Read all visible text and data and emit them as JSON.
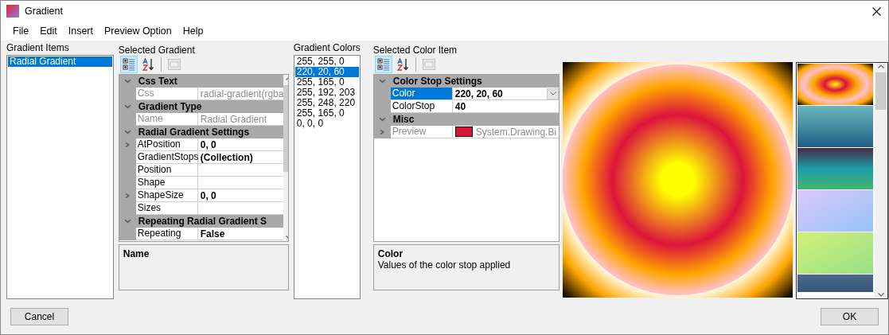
{
  "window": {
    "title": "Gradient"
  },
  "menu": [
    {
      "label": "File"
    },
    {
      "label": "Edit"
    },
    {
      "label": "Insert"
    },
    {
      "label": "Preview Option"
    },
    {
      "label": "Help"
    }
  ],
  "gradient_items": {
    "label": "Gradient Items",
    "items": [
      {
        "label": "Radial Gradient",
        "selected": true
      }
    ]
  },
  "selected_gradient": {
    "label": "Selected Gradient",
    "toolbar": [
      {
        "kind": "categorized",
        "selected": true
      },
      {
        "kind": "alphabetical",
        "selected": false
      },
      {
        "kind": "property-pages",
        "disabled": true
      }
    ],
    "categories": [
      {
        "title": "Css Text",
        "expanded": true,
        "properties": [
          {
            "name": "Css",
            "value": "radial-gradient(rgba",
            "readonly": true,
            "expandable": false,
            "selected": false
          }
        ]
      },
      {
        "title": "Gradient Type",
        "expanded": true,
        "properties": [
          {
            "name": "Name",
            "value": "Radial Gradient",
            "readonly": true,
            "expandable": false,
            "selected": false
          }
        ]
      },
      {
        "title": "Radial Gradient Settings",
        "expanded": true,
        "properties": [
          {
            "name": "AtPosition",
            "value": "0, 0",
            "readonly": false,
            "expandable": true,
            "selected": false
          },
          {
            "name": "GradientStops",
            "value": "(Collection)",
            "readonly": false,
            "expandable": false,
            "selected": false
          },
          {
            "name": "Position",
            "readonly": false,
            "expandable": false,
            "selected": false
          },
          {
            "name": "Shape",
            "readonly": false,
            "expandable": false,
            "selected": false
          },
          {
            "name": "ShapeSize",
            "value": "0, 0",
            "readonly": false,
            "expandable": true,
            "selected": false
          },
          {
            "name": "Sizes",
            "readonly": false,
            "expandable": false,
            "selected": false
          }
        ]
      },
      {
        "title": "Repeating Radial Gradient S",
        "expanded": true,
        "properties": [
          {
            "name": "Repeating",
            "value": "False",
            "readonly": false,
            "expandable": false,
            "selected": false
          }
        ]
      }
    ],
    "help": {
      "title": "Name"
    }
  },
  "gradient_colors": {
    "label": "Gradient Colors",
    "items": [
      {
        "label": "255, 255, 0",
        "selected": false
      },
      {
        "label": "220, 20, 60",
        "selected": true
      },
      {
        "label": "255, 165, 0",
        "selected": false
      },
      {
        "label": "255, 192, 203",
        "selected": false
      },
      {
        "label": "255, 248, 220",
        "selected": false
      },
      {
        "label": "255, 165, 0",
        "selected": false
      },
      {
        "label": "0, 0, 0",
        "selected": false
      }
    ]
  },
  "selected_color_item": {
    "label": "Selected Color Item",
    "toolbar": [
      {
        "kind": "categorized",
        "selected": true
      },
      {
        "kind": "alphabetical",
        "selected": false
      },
      {
        "kind": "property-pages",
        "disabled": true
      }
    ],
    "categories": [
      {
        "title": "Color Stop Settings",
        "expanded": true,
        "properties": [
          {
            "name": "Color",
            "value": "220, 20, 60",
            "kind": "dropdown",
            "readonly": false,
            "expandable": false,
            "selected": true
          },
          {
            "name": "ColorStop",
            "value": "40",
            "readonly": false,
            "expandable": false,
            "selected": false
          }
        ]
      },
      {
        "title": "Misc",
        "expanded": true,
        "properties": [
          {
            "name": "Preview",
            "value": "System.Drawing.Bi",
            "color": "#dc143c",
            "readonly": true,
            "expandable": true,
            "selected": false
          }
        ]
      }
    ],
    "help": {
      "title": "Color",
      "text": "Values of the color stop applied"
    }
  },
  "buttons": [
    {
      "label": "Cancel"
    },
    {
      "label": "OK"
    }
  ]
}
